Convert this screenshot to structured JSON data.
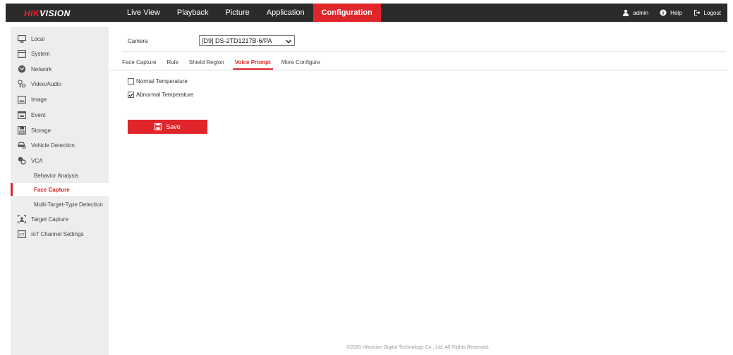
{
  "app": {
    "logo_main": "HIK",
    "logo_rest": "VISION"
  },
  "topnav": {
    "items": [
      {
        "label": "Live View",
        "active": false
      },
      {
        "label": "Playback",
        "active": false
      },
      {
        "label": "Picture",
        "active": false
      },
      {
        "label": "Application",
        "active": false
      },
      {
        "label": "Configuration",
        "active": true
      }
    ]
  },
  "userbar": {
    "user": "admin",
    "help": "Help",
    "logout": "Logout"
  },
  "sidebar": {
    "items": [
      {
        "label": "Local",
        "icon": "monitor-icon"
      },
      {
        "label": "System",
        "icon": "system-icon"
      },
      {
        "label": "Network",
        "icon": "network-icon"
      },
      {
        "label": "Video/Audio",
        "icon": "video-audio-icon"
      },
      {
        "label": "Image",
        "icon": "image-icon"
      },
      {
        "label": "Event",
        "icon": "event-icon"
      },
      {
        "label": "Storage",
        "icon": "storage-icon"
      },
      {
        "label": "Vehicle Detection",
        "icon": "vehicle-icon"
      },
      {
        "label": "VCA",
        "icon": "vca-icon"
      }
    ],
    "sub_items": [
      {
        "label": "Behavior Analysis",
        "active": false
      },
      {
        "label": "Face Capture",
        "active": true
      },
      {
        "label": "Multi-Target-Type Detection",
        "active": false
      }
    ],
    "items_after": [
      {
        "label": "Target Capture",
        "icon": "target-capture-icon"
      },
      {
        "label": "IoT Channel Settings",
        "icon": "iot-icon"
      }
    ]
  },
  "main": {
    "camera_label": "Camera",
    "camera_value": "[D9] DS-2TD1217B-6/PA",
    "tabs": [
      {
        "label": "Face Capture",
        "active": false
      },
      {
        "label": "Rule",
        "active": false
      },
      {
        "label": "Shield Region",
        "active": false
      },
      {
        "label": "Voice Prompt",
        "active": true
      },
      {
        "label": "More Configure",
        "active": false
      }
    ],
    "options": [
      {
        "label": "Normal Temperature",
        "checked": false
      },
      {
        "label": "Abnormal Temperature",
        "checked": true
      }
    ],
    "save_label": "Save"
  },
  "footer": {
    "text": "©2020 Hikvision Digital Technology Co., Ltd. All Rights Reserved."
  },
  "colors": {
    "accent": "#e0262a",
    "topbar": "#2b2b2b",
    "sidebar": "#ededed"
  }
}
